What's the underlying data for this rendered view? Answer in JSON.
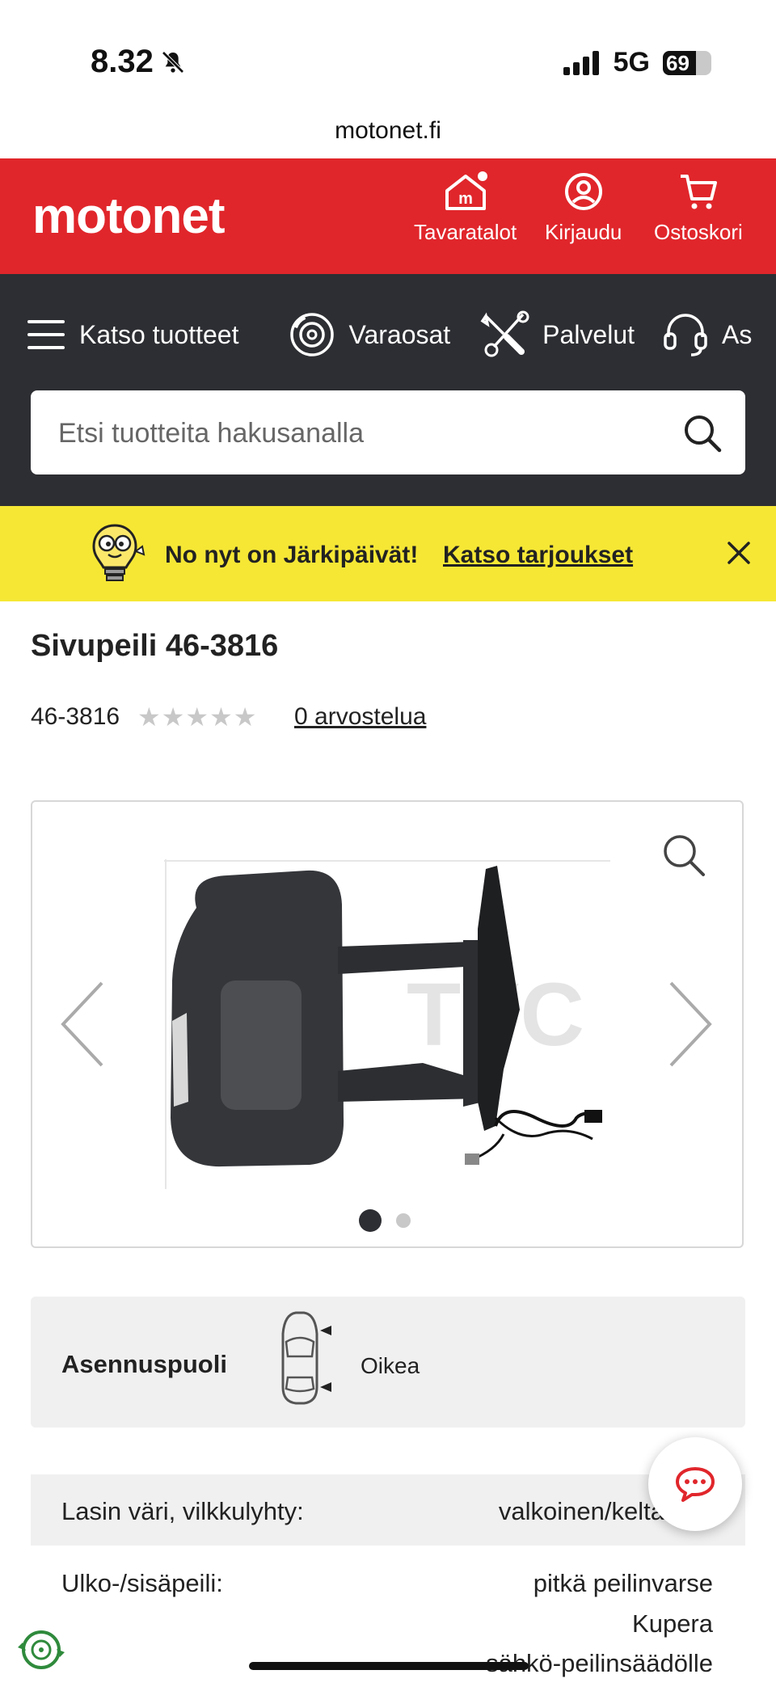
{
  "status_bar": {
    "time": "8.32",
    "network": "5G",
    "battery": "69",
    "battery_level": 0.69
  },
  "browser": {
    "url": "motonet.fi"
  },
  "header": {
    "logo": "motonet",
    "stores_label": "Tavaratalot",
    "login_label": "Kirjaudu",
    "cart_label": "Ostoskori"
  },
  "nav": {
    "products_label": "Katso tuotteet",
    "parts_label": "Varaosat",
    "services_label": "Palvelut",
    "support_label": "As"
  },
  "search": {
    "placeholder": "Etsi tuotteita hakusanalla"
  },
  "promo": {
    "text": "No nyt on Järkipäivät!",
    "link": "Katso tarjoukset"
  },
  "product": {
    "title": "Sivupeili 46-3816",
    "sku": "46-3816",
    "stars": "★★★★★",
    "reviews_link": "0 arvostelua",
    "gallery": {
      "slide_count": 2,
      "active_slide": 1,
      "image_watermark": "TYC"
    }
  },
  "fitment": {
    "label": "Asennuspuoli",
    "value": "Oikea"
  },
  "specs": [
    {
      "label": "Lasin väri, vilkkulyhty:",
      "value": "valkoinen/kelta"
    },
    {
      "label": "Ulko-/sisäpeili:",
      "value": "pitkä peilinvarse"
    },
    {
      "label": "",
      "value": "Kupera"
    },
    {
      "label": "",
      "value": "sähkö-peilinsäädölle"
    }
  ],
  "colors": {
    "brand_red": "#e0262b",
    "nav_dark": "#2d2e33",
    "promo_yellow": "#f6e735"
  }
}
